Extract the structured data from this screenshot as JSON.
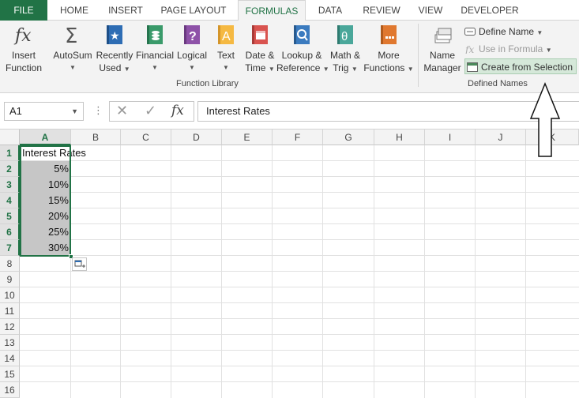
{
  "tabs": [
    "FILE",
    "HOME",
    "INSERT",
    "PAGE LAYOUT",
    "FORMULAS",
    "DATA",
    "REVIEW",
    "VIEW",
    "DEVELOPER"
  ],
  "active_tab": "FORMULAS",
  "ribbon": {
    "insert_function": [
      "Insert",
      "Function"
    ],
    "autosum": "AutoSum",
    "recently_used": [
      "Recently",
      "Used"
    ],
    "financial": "Financial",
    "logical": "Logical",
    "text": "Text",
    "date_time": [
      "Date &",
      "Time"
    ],
    "lookup_reference": [
      "Lookup &",
      "Reference"
    ],
    "math_trig": [
      "Math &",
      "Trig"
    ],
    "more_functions": [
      "More",
      "Functions"
    ],
    "function_library_label": "Function Library",
    "name_manager": [
      "Name",
      "Manager"
    ],
    "define_name": "Define Name",
    "use_in_formula": "Use in Formula",
    "create_from_selection": "Create from Selection",
    "defined_names_label": "Defined Names"
  },
  "formula_bar": {
    "name_box": "A1",
    "fx_label": "fx",
    "content": "Interest Rates"
  },
  "columns": [
    "A",
    "B",
    "C",
    "D",
    "E",
    "F",
    "G",
    "H",
    "I",
    "J",
    "K"
  ],
  "rows": [
    "1",
    "2",
    "3",
    "4",
    "5",
    "6",
    "7",
    "8",
    "9",
    "10",
    "11",
    "12",
    "13",
    "14",
    "15",
    "16"
  ],
  "cells": {
    "A1": "Interest Rates",
    "A2": "5%",
    "A3": "10%",
    "A4": "15%",
    "A5": "20%",
    "A6": "25%",
    "A7": "30%"
  },
  "colors": {
    "accent": "#217346",
    "selection": "#c6c6c6",
    "highlight": "#d5e8d9"
  }
}
